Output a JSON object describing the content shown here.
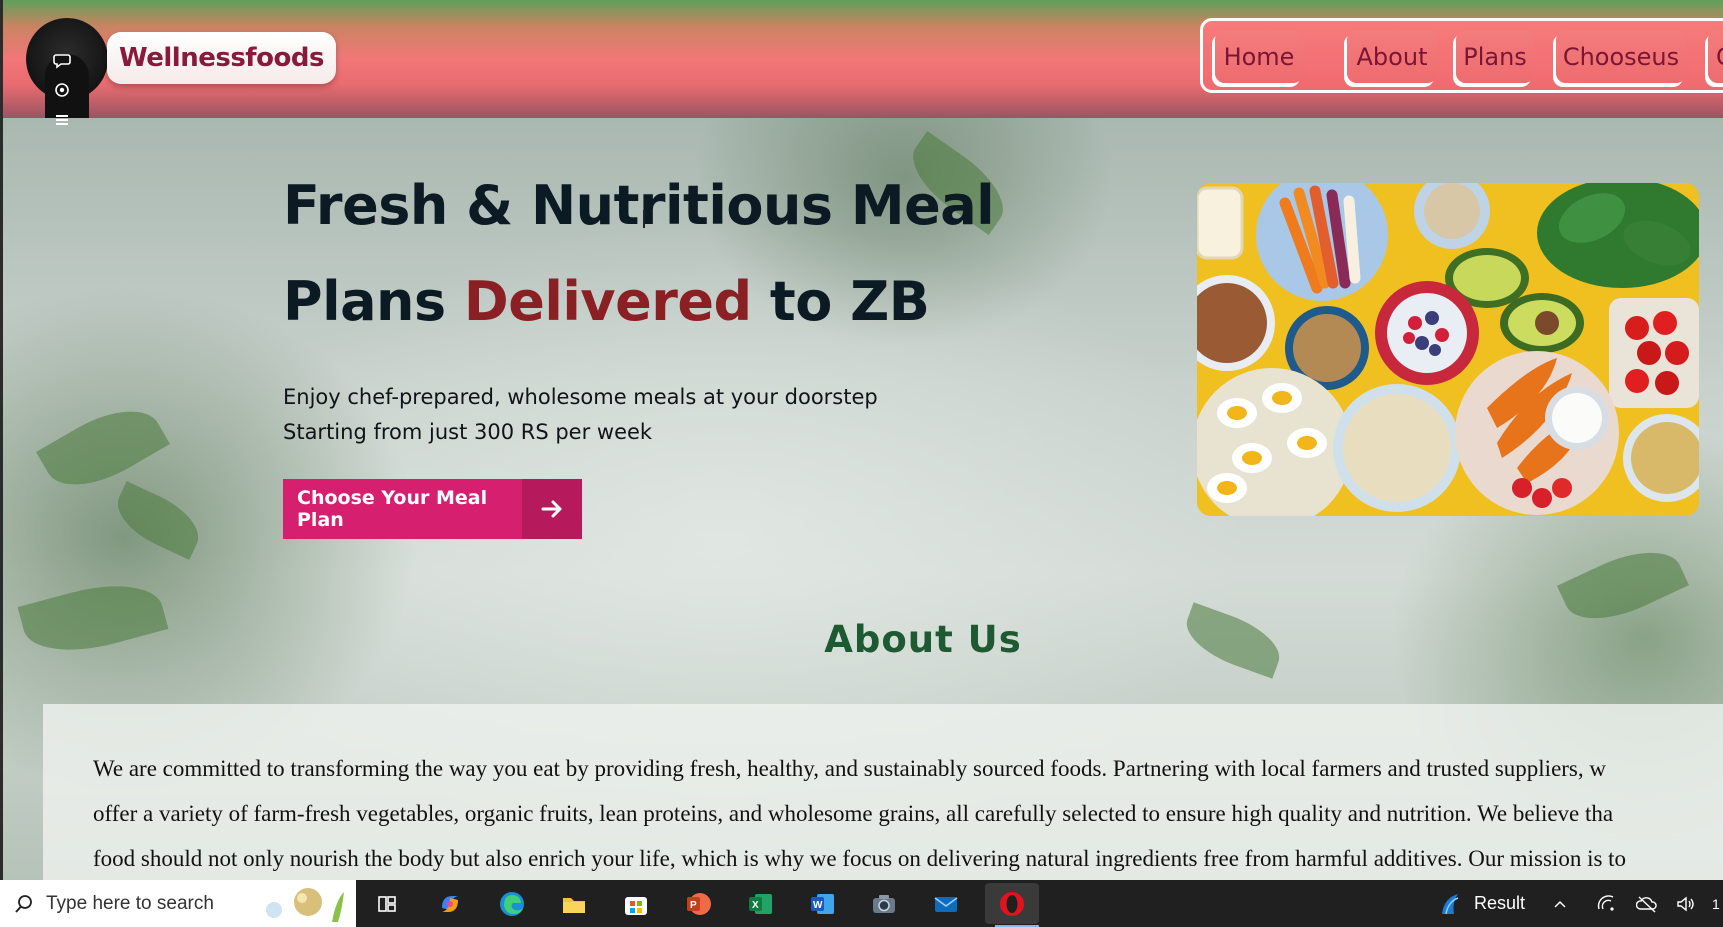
{
  "brand": {
    "name": "Wellnessfoods"
  },
  "nav": {
    "home": "Home",
    "about": "About",
    "plans": "Plans",
    "choose_us": "Chooseus",
    "contact_partial": "C"
  },
  "hero": {
    "title_line1": "Fresh & Nutritious Meal",
    "title_line2_start": "Plans ",
    "title_line2_accent": "Delivered",
    "title_line2_end": " to ZB",
    "subtitle_line1": "Enjoy chef-prepared, wholesome meals at your doorstep",
    "subtitle_line2": "Starting from just 300 RS per week",
    "cta_label": "Choose Your Meal Plan"
  },
  "about": {
    "heading": "About Us",
    "paragraph": "We are committed to transforming the way you eat by providing fresh, healthy, and sustainably sourced foods. Partnering with local farmers and trusted suppliers, w\noffer a variety of farm-fresh vegetables, organic fruits, lean proteins, and wholesome grains, all carefully selected to ensure high quality and nutrition. We believe tha\nfood should not only nourish the body but also enrich your life, which is why we focus on delivering natural ingredients free from harmful additives. Our mission is to"
  },
  "taskbar": {
    "search_placeholder": "Type here to search",
    "tray_label": "Result",
    "clock_partial": "1"
  },
  "colors": {
    "accent": "#d6206f",
    "brand_text": "#8a1a3c",
    "heading_green": "#1d5a32",
    "accent_word": "#8a1f24"
  }
}
